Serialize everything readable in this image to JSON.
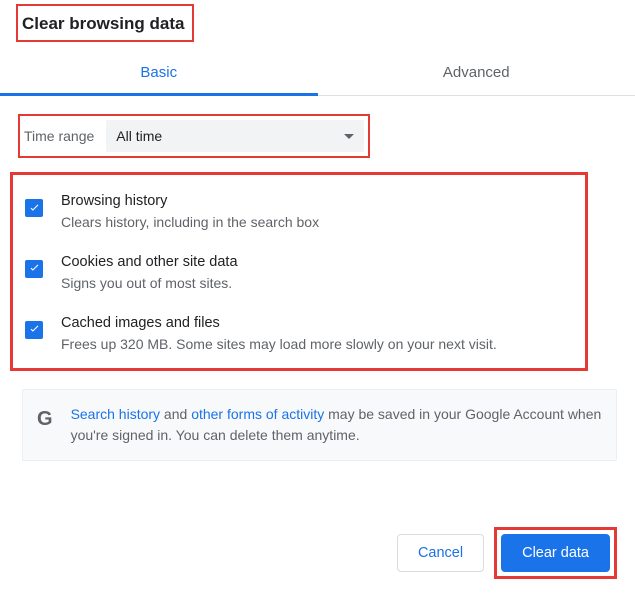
{
  "dialog": {
    "title": "Clear browsing data"
  },
  "tabs": {
    "basic": "Basic",
    "advanced": "Advanced"
  },
  "timerange": {
    "label": "Time range",
    "value": "All time"
  },
  "options": {
    "browsing": {
      "title": "Browsing history",
      "desc": "Clears history, including in the search box"
    },
    "cookies": {
      "title": "Cookies and other site data",
      "desc": "Signs you out of most sites."
    },
    "cache": {
      "title": "Cached images and files",
      "desc": "Frees up 320 MB. Some sites may load more slowly on your next visit."
    }
  },
  "info": {
    "link_search": "Search history",
    "between": " and ",
    "link_other": "other forms of activity",
    "rest": " may be saved in your Google Account when you're signed in. You can delete them anytime."
  },
  "buttons": {
    "cancel": "Cancel",
    "clear": "Clear data"
  }
}
